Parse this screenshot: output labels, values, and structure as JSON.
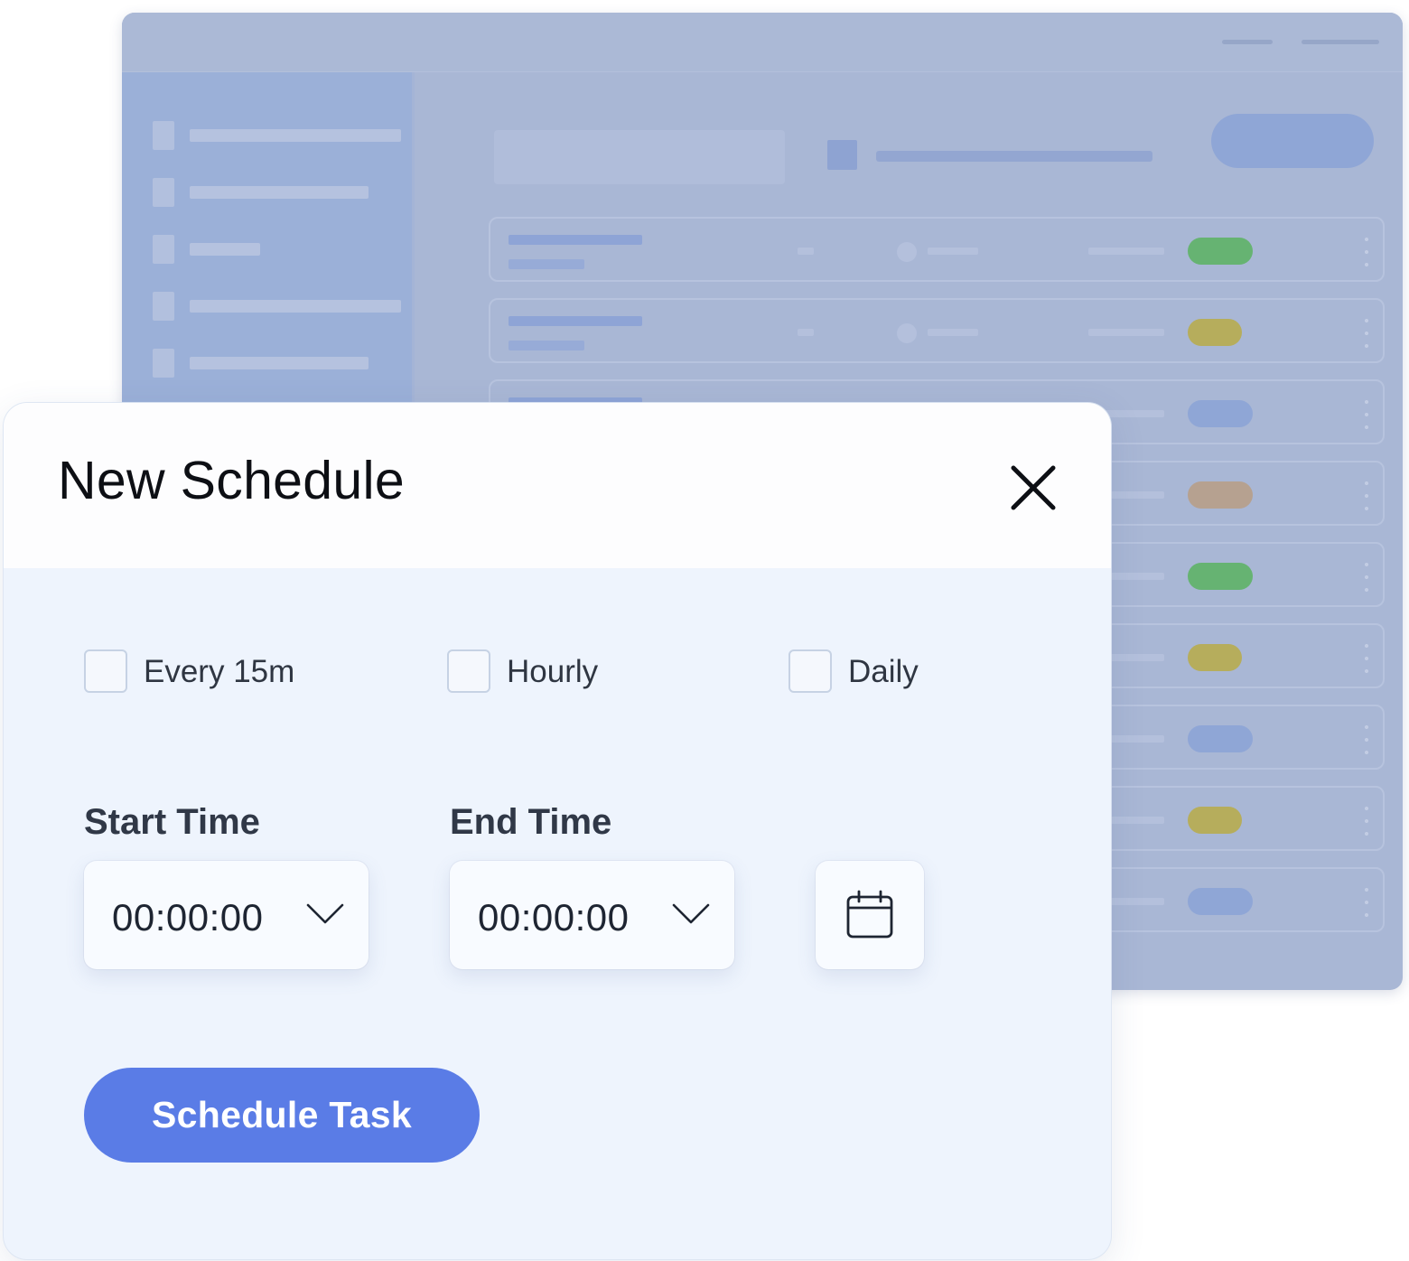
{
  "background_app": {
    "status_pill_colors": [
      "#66b372",
      "#b6ad5c",
      "#8fa6d6",
      "#b6a190",
      "#66b372",
      "#b6ad5c",
      "#8fa6d6",
      "#b6ad5c",
      "#8fa6d6"
    ]
  },
  "modal": {
    "title": "New Schedule",
    "close_icon": "close-icon",
    "frequency_options": [
      {
        "label": "Every 15m",
        "checked": false
      },
      {
        "label": "Hourly",
        "checked": false
      },
      {
        "label": "Daily",
        "checked": false
      }
    ],
    "start_time": {
      "label": "Start Time",
      "value": "00:00:00",
      "icon": "chevron-down-icon"
    },
    "end_time": {
      "label": "End Time",
      "value": "00:00:00",
      "icon": "chevron-down-icon"
    },
    "calendar_icon": "calendar-icon",
    "submit_label": "Schedule Task"
  },
  "colors": {
    "primary": "#5a7ce6",
    "modal_body": "#eef4fd",
    "title_text": "#0d0f14"
  }
}
